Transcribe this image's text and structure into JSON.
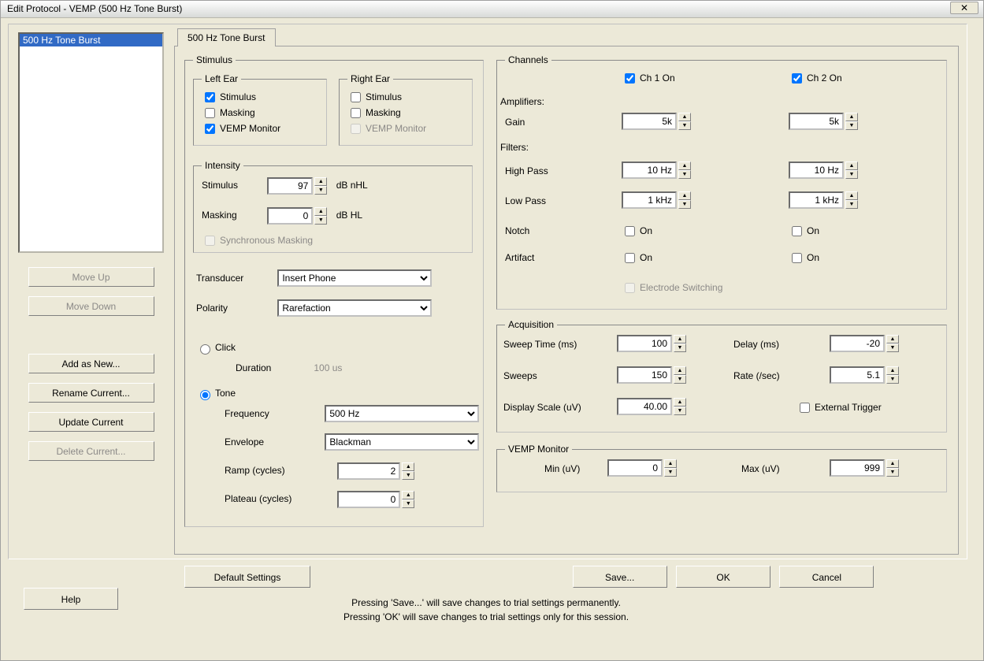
{
  "window": {
    "title": "Edit Protocol - VEMP (500 Hz Tone Burst)"
  },
  "sidebar": {
    "items": [
      "500 Hz Tone Burst"
    ],
    "move_up": "Move Up",
    "move_down": "Move Down",
    "add_new": "Add as New...",
    "rename": "Rename Current...",
    "update": "Update Current",
    "delete": "Delete Current..."
  },
  "tab": {
    "label": "500 Hz Tone Burst"
  },
  "stimulus": {
    "legend": "Stimulus",
    "left_ear": {
      "legend": "Left Ear",
      "stimulus_lbl": "Stimulus",
      "stimulus_chk": true,
      "masking_lbl": "Masking",
      "masking_chk": false,
      "vemp_lbl": "VEMP Monitor",
      "vemp_chk": true
    },
    "right_ear": {
      "legend": "Right Ear",
      "stimulus_lbl": "Stimulus",
      "stimulus_chk": false,
      "masking_lbl": "Masking",
      "masking_chk": false,
      "vemp_lbl": "VEMP Monitor"
    },
    "intensity": {
      "legend": "Intensity",
      "stimulus_lbl": "Stimulus",
      "stimulus_val": "97",
      "stimulus_unit": "dB nHL",
      "masking_lbl": "Masking",
      "masking_val": "0",
      "masking_unit": "dB HL",
      "sync_lbl": "Synchronous Masking"
    },
    "transducer_lbl": "Transducer",
    "transducer_val": "Insert Phone",
    "polarity_lbl": "Polarity",
    "polarity_val": "Rarefaction",
    "click_lbl": "Click",
    "duration_lbl": "Duration",
    "duration_val": "100 us",
    "tone_lbl": "Tone",
    "frequency_lbl": "Frequency",
    "frequency_val": "500 Hz",
    "envelope_lbl": "Envelope",
    "envelope_val": "Blackman",
    "ramp_lbl": "Ramp (cycles)",
    "ramp_val": "2",
    "plateau_lbl": "Plateau (cycles)",
    "plateau_val": "0"
  },
  "channels": {
    "legend": "Channels",
    "ch1_lbl": "Ch 1 On",
    "ch1_chk": true,
    "ch2_lbl": "Ch 2 On",
    "ch2_chk": true,
    "amplifiers_lbl": "Amplifiers:",
    "gain_lbl": "Gain",
    "gain1_val": "5k",
    "gain2_val": "5k",
    "filters_lbl": "Filters:",
    "hp_lbl": "High Pass",
    "hp1_val": "10 Hz",
    "hp2_val": "10 Hz",
    "lp_lbl": "Low Pass",
    "lp1_val": "1 kHz",
    "lp2_val": "1 kHz",
    "notch_lbl": "Notch",
    "on_lbl": "On",
    "artifact_lbl": "Artifact",
    "electrode_lbl": "Electrode Switching"
  },
  "acquisition": {
    "legend": "Acquisition",
    "sweep_time_lbl": "Sweep Time (ms)",
    "sweep_time_val": "100",
    "delay_lbl": "Delay (ms)",
    "delay_val": "-20",
    "sweeps_lbl": "Sweeps",
    "sweeps_val": "150",
    "rate_lbl": "Rate (/sec)",
    "rate_val": "5.1",
    "display_scale_lbl": "Display Scale (uV)",
    "display_scale_val": "40.00",
    "ext_trigger_lbl": "External Trigger"
  },
  "vemp_monitor": {
    "legend": "VEMP Monitor",
    "min_lbl": "Min (uV)",
    "min_val": "0",
    "max_lbl": "Max (uV)",
    "max_val": "999"
  },
  "footer": {
    "default_settings": "Default Settings",
    "save": "Save...",
    "ok": "OK",
    "cancel": "Cancel",
    "help": "Help",
    "note1": "Pressing 'Save...' will save changes to trial settings permanently.",
    "note2": "Pressing 'OK' will save changes to trial settings only for this session."
  }
}
